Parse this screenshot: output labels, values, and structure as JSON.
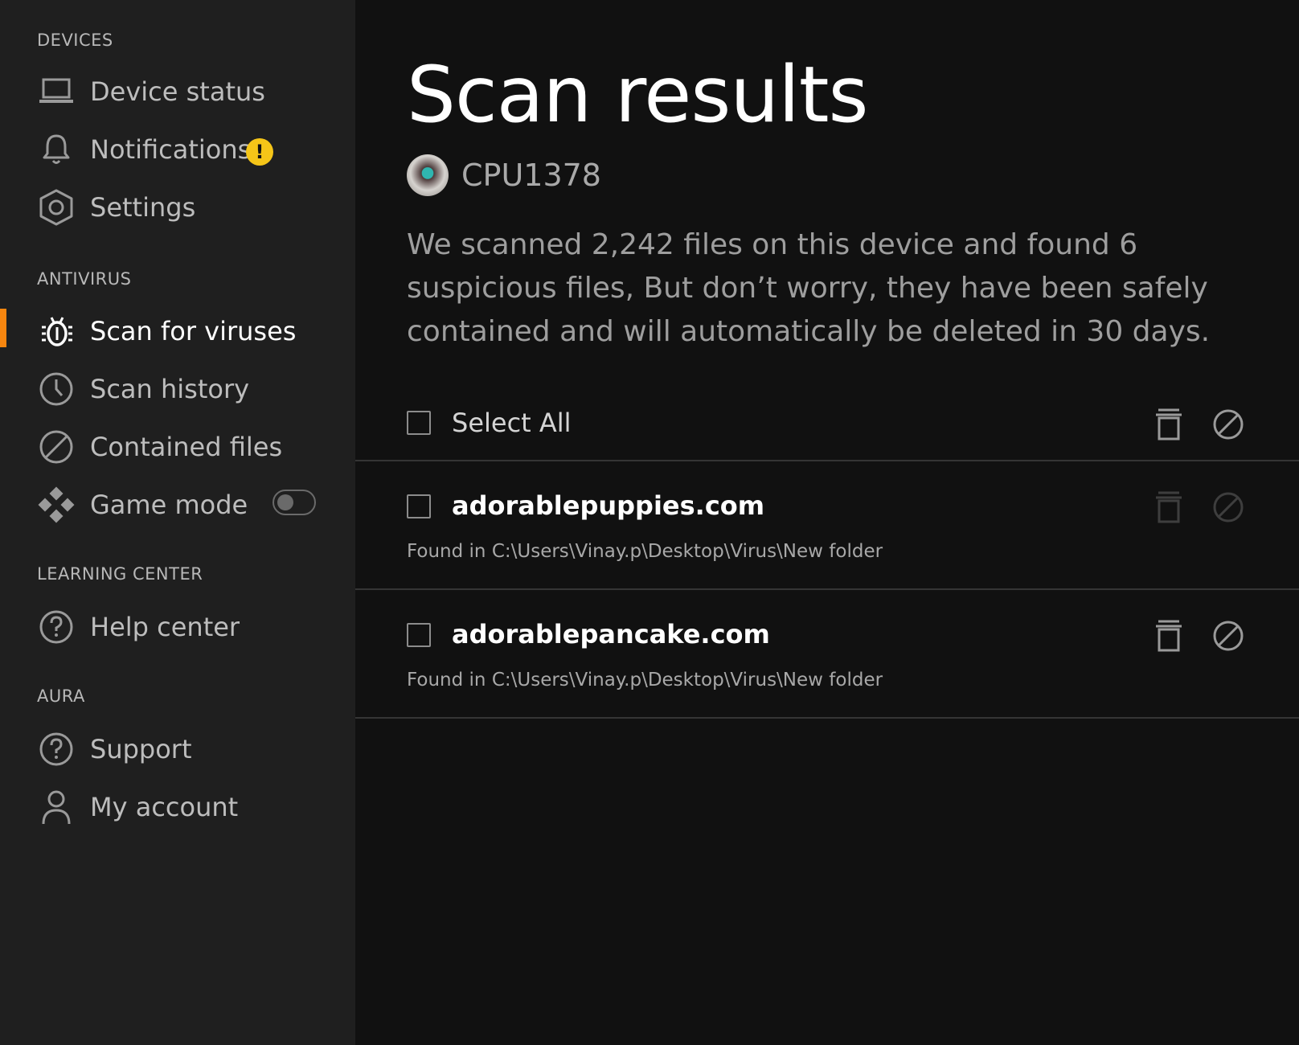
{
  "sidebar": {
    "sections": [
      {
        "title": "DEVICES",
        "items": [
          {
            "label": "Device status",
            "icon": "laptop-icon"
          },
          {
            "label": "Notifications",
            "icon": "bell-icon",
            "badge": "!"
          },
          {
            "label": "Settings",
            "icon": "gear-icon"
          }
        ]
      },
      {
        "title": "ANTIVIRUS",
        "items": [
          {
            "label": "Scan for viruses",
            "icon": "bug-icon",
            "active": true
          },
          {
            "label": "Scan history",
            "icon": "clock-icon"
          },
          {
            "label": "Contained files",
            "icon": "block-icon"
          },
          {
            "label": "Game mode",
            "icon": "gamepad-icon",
            "toggle": false
          }
        ]
      },
      {
        "title": "LEARNING CENTER",
        "items": [
          {
            "label": "Help center",
            "icon": "question-icon"
          }
        ]
      },
      {
        "title": "AURA",
        "items": [
          {
            "label": "Support",
            "icon": "question-icon"
          },
          {
            "label": "My account",
            "icon": "user-icon"
          }
        ]
      }
    ]
  },
  "main": {
    "title": "Scan results",
    "device_name": "CPU1378",
    "description": "We scanned 2,242 files on this device and found 6 suspicious files, But don’t worry, they have been safely contained and will automatically be deleted in 30 days.",
    "select_all_label": "Select All",
    "files": [
      {
        "name": "adorablepuppies.com",
        "path": "Found in C:\\Users\\Vinay.p\\Desktop\\Virus\\New folder",
        "actions_enabled": false
      },
      {
        "name": "adorablepancake.com",
        "path": "Found in C:\\Users\\Vinay.p\\Desktop\\Virus\\New folder",
        "actions_enabled": true
      }
    ]
  },
  "colors": {
    "sidebar_bg": "#1f1f1f",
    "main_bg": "#111111",
    "accent": "#f7860f",
    "warning_badge": "#f5c518"
  }
}
